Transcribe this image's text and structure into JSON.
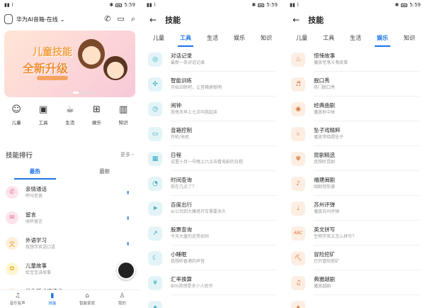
{
  "status": {
    "left": "▮▮ ⌇",
    "time": "5:59"
  },
  "home": {
    "device": "华为AI音箱-在线",
    "banner": {
      "line1": "儿童技能",
      "line2": "全新升级"
    },
    "categories": [
      {
        "icon": "baby-face-icon",
        "glyph": "☺",
        "label": "儿童"
      },
      {
        "icon": "toolbox-icon",
        "glyph": "▣",
        "label": "工具"
      },
      {
        "icon": "coffee-cup-icon",
        "glyph": "☕",
        "label": "生活"
      },
      {
        "icon": "gamepad-icon",
        "glyph": "⊞",
        "label": "娱乐"
      },
      {
        "icon": "book-icon",
        "glyph": "▥",
        "label": "知识"
      }
    ],
    "section_title": "技能排行",
    "more": "更多 ›",
    "tabs": [
      "最热",
      "最新"
    ],
    "skills": [
      {
        "name": "亲情通话",
        "desc": "呼叫老爸",
        "glyph": "✆",
        "bg": "#fde4ec",
        "fg": "#e06a93"
      },
      {
        "name": "留言",
        "desc": "收听留言",
        "glyph": "✉",
        "bg": "#fde4ec",
        "fg": "#e06a93"
      },
      {
        "name": "外语学习",
        "desc": "我想学英语口语",
        "glyph": "文",
        "bg": "#fdf0dc",
        "fg": "#e8a13c"
      },
      {
        "name": "儿童故事",
        "desc": "给宝宝讲故事",
        "glyph": "✿",
        "bg": "#fdf6d3",
        "fg": "#e0b422"
      },
      {
        "name": "学生版成语接龙",
        "desc": "打开学生版成语接龙",
        "glyph": "✎",
        "bg": "#fdeee3",
        "fg": "#e08a47"
      }
    ],
    "bottom_nav": [
      {
        "icon": "music-note-icon",
        "glyph": "♫",
        "label": "音乐有声"
      },
      {
        "icon": "skills-icon",
        "glyph": "▮",
        "label": "技能"
      },
      {
        "icon": "smart-home-icon",
        "glyph": "⌂",
        "label": "智能家居"
      },
      {
        "icon": "person-icon",
        "glyph": "♙",
        "label": "我的"
      }
    ]
  },
  "skills_page": {
    "title": "技能",
    "tabs": [
      "儿童",
      "工具",
      "生活",
      "娱乐",
      "知识"
    ],
    "tools": [
      {
        "name": "对话记录",
        "desc": "最新一条对话记录",
        "glyph": "◎"
      },
      {
        "name": "智能训练",
        "desc": "开始训练吧，让音箱更聪明",
        "glyph": "✣"
      },
      {
        "name": "闹钟",
        "desc": "我每天早上七点叫我起床",
        "glyph": "◷"
      },
      {
        "name": "音箱控制",
        "desc": "开机/关机",
        "glyph": "▭"
      },
      {
        "name": "日程",
        "desc": "设置十月一号晚上六点去看电影的日程",
        "glyph": "▦"
      },
      {
        "name": "时间查询",
        "desc": "现在几点了？",
        "glyph": "◔"
      },
      {
        "name": "百度出行",
        "desc": "从公司到大雁塔开车需要多久",
        "glyph": "➤"
      },
      {
        "name": "股票查询",
        "desc": "今天大盘的走势如何",
        "glyph": "↗"
      },
      {
        "name": "小睡眠",
        "desc": "我想听香港的声音",
        "glyph": "☾"
      },
      {
        "name": "汇率换算",
        "desc": "800英镑是多少人民币",
        "glyph": "¥"
      },
      {
        "name": "",
        "desc": "",
        "glyph": "✦"
      }
    ],
    "entertainment": [
      {
        "name": "惊悚故事",
        "desc": "播放老鬼斗鬼故事",
        "glyph": "♨"
      },
      {
        "name": "脱口秀",
        "desc": "热门脱口秀",
        "glyph": "♬"
      },
      {
        "name": "经典曲剧",
        "desc": "播放析中体",
        "glyph": "◉"
      },
      {
        "name": "坠子戏精粹",
        "desc": "播放李晓霞坠子",
        "glyph": "♭"
      },
      {
        "name": "昆剧精选",
        "desc": "我想听昆剧",
        "glyph": "✾"
      },
      {
        "name": "福建闽剧",
        "desc": "闽剧怪陈婆",
        "glyph": "♪"
      },
      {
        "name": "苏州评弹",
        "desc": "播放苏州评弹",
        "glyph": "♩"
      },
      {
        "name": "英文拼写",
        "desc": "生物学英文怎么拼写？",
        "glyph": "ABC"
      },
      {
        "name": "冒险挖矿",
        "desc": "打开冒险挖矿",
        "glyph": "⛏"
      },
      {
        "name": "典雅越剧",
        "desc": "播放越剧",
        "glyph": "♫"
      },
      {
        "name": "",
        "desc": "",
        "glyph": "✦"
      }
    ]
  }
}
